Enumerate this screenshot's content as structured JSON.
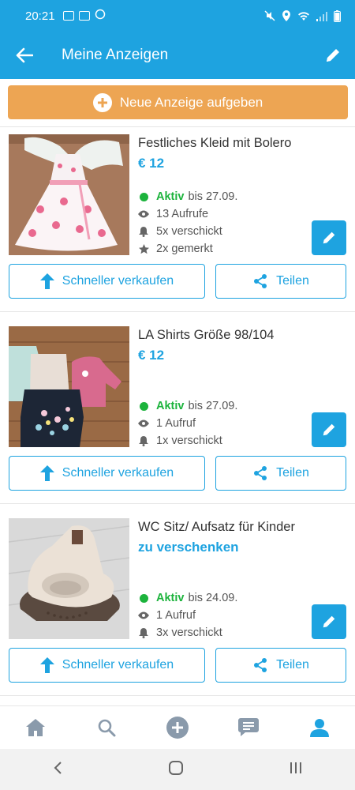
{
  "status_bar": {
    "time": "20:21"
  },
  "header": {
    "title": "Meine Anzeigen"
  },
  "new_ad": {
    "label": "Neue Anzeige aufgeben"
  },
  "listings": [
    {
      "title": "Festliches Kleid mit Bolero",
      "price": "€ 12",
      "status": "Aktiv",
      "until": "bis 27.09.",
      "views": "13 Aufrufe",
      "sent": "5x verschickt",
      "saved": "2x gemerkt",
      "sell_label": "Schneller verkaufen",
      "share_label": "Teilen"
    },
    {
      "title": "LA Shirts Größe 98/104",
      "price": "€ 12",
      "status": "Aktiv",
      "until": "bis 27.09.",
      "views": "1 Aufruf",
      "sent": "1x verschickt",
      "sell_label": "Schneller verkaufen",
      "share_label": "Teilen"
    },
    {
      "title": "WC Sitz/ Aufsatz für Kinder",
      "price": "zu verschenken",
      "status": "Aktiv",
      "until": "bis 24.09.",
      "views": "1 Aufruf",
      "sent": "3x verschickt",
      "sell_label": "Schneller verkaufen",
      "share_label": "Teilen"
    }
  ],
  "bottom_nav": [
    "home-icon",
    "search-icon",
    "add-icon",
    "messages-icon",
    "profile-icon"
  ],
  "colors": {
    "primary": "#1ea3e0",
    "accent": "#eda553",
    "active": "#1cb33c"
  }
}
